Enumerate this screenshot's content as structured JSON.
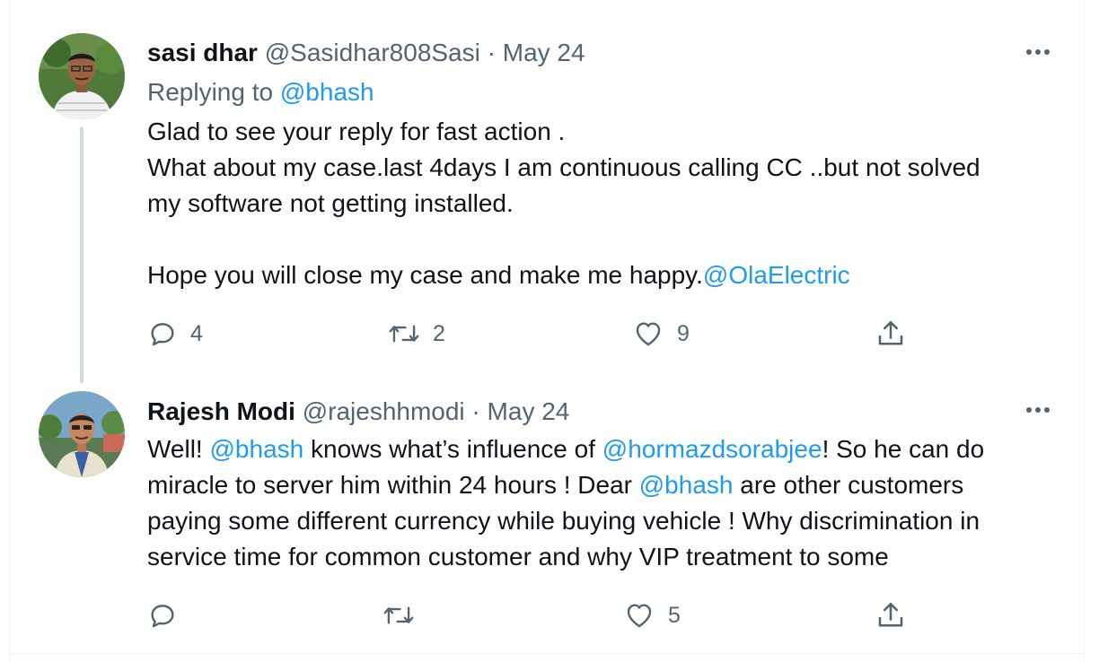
{
  "tweets": [
    {
      "display_name": "sasi dhar",
      "handle": "@Sasidhar808Sasi",
      "separator": "·",
      "date": "May 24",
      "replying_prefix": "Replying to",
      "replying_to": "@bhash",
      "lines": [
        "Glad to see your reply for fast action .",
        "What about my case.last 4days I am continuous calling CC ..but not solved",
        "my software not getting installed."
      ],
      "line4_text": "Hope you will close my case and make me happy.",
      "line4_mention": "@OlaElectric",
      "reply_count": "4",
      "retweet_count": "2",
      "like_count": "9"
    },
    {
      "display_name": "Rajesh Modi",
      "handle": "@rajeshhmodi",
      "separator": "·",
      "date": "May 24",
      "l1_a": "Well! ",
      "l1_m1": "@bhash",
      "l1_b": " knows what’s influence of ",
      "l1_m2": "@hormazdsorabjee",
      "l1_c": "! So he can do",
      "l2_a": "miracle to server him within 24 hours ! Dear ",
      "l2_m": "@bhash",
      "l2_b": " are other customers",
      "l3": "paying some different currency while buying vehicle ! Why discrimination in",
      "l4": "service time for common customer and why VIP treatment to some",
      "reply_count": "",
      "retweet_count": "",
      "like_count": "5"
    }
  ],
  "icons": {
    "reply": "reply-icon",
    "retweet": "retweet-icon",
    "like": "heart-icon",
    "share": "share-icon",
    "more": "more-icon"
  },
  "colors": {
    "text": "#0f1419",
    "muted": "#536471",
    "link": "#1d9bf0",
    "thread_line": "#cfd9de"
  }
}
